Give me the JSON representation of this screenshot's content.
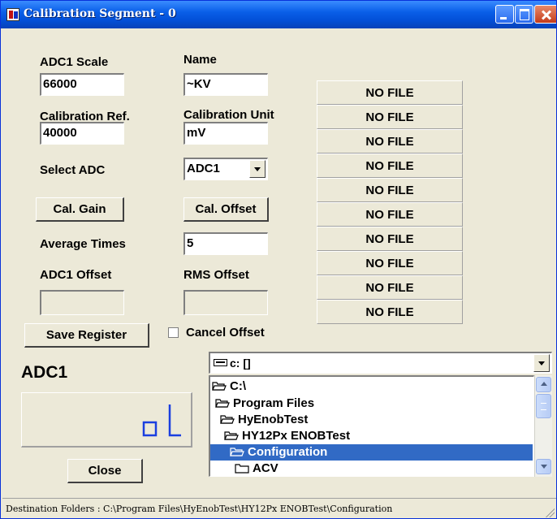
{
  "window": {
    "title": "Calibration Segment - 0"
  },
  "labels": {
    "adc1_scale": "ADC1 Scale",
    "name": "Name",
    "calibration_ref": "Calibration Ref.",
    "calibration_unit": "Calibration Unit",
    "select_adc": "Select  ADC",
    "average_times": "Average Times",
    "adc1_offset": "ADC1 Offset",
    "rms_offset": "RMS Offset",
    "adc_display": "ADC1"
  },
  "fields": {
    "adc1_scale": "66000",
    "name": "~KV",
    "calibration_ref": "40000",
    "calibration_unit": "mV",
    "select_adc": "ADC1",
    "average_times": "5",
    "adc1_offset": "",
    "rms_offset": ""
  },
  "buttons": {
    "cal_gain": "Cal. Gain",
    "cal_offset": "Cal. Offset",
    "save_register": "Save Register",
    "close": "Close"
  },
  "cancel_offset": {
    "label": "Cancel Offset",
    "checked": false
  },
  "display_value": "oL",
  "files": [
    "NO FILE",
    "NO FILE",
    "NO FILE",
    "NO FILE",
    "NO FILE",
    "NO FILE",
    "NO FILE",
    "NO FILE",
    "NO FILE",
    "NO FILE"
  ],
  "drive": {
    "value": "c: []"
  },
  "folders": [
    "C:\\",
    "Program Files",
    "HyEnobTest",
    "HY12Px ENOBTest",
    "Configuration",
    "ACV"
  ],
  "status": "Destination Folders : C:\\Program Files\\HyEnobTest\\HY12Px ENOBTest\\Configuration"
}
